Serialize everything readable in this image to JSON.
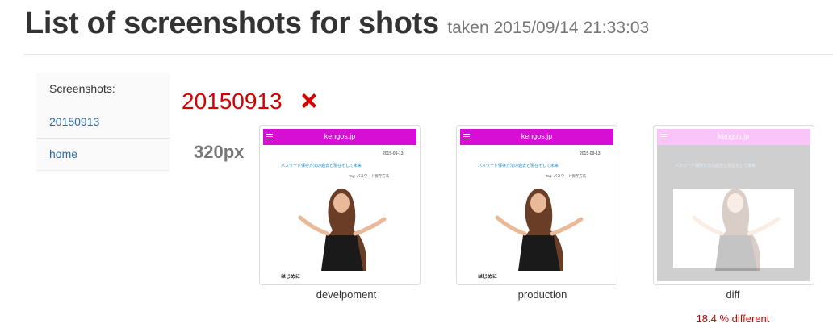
{
  "header": {
    "title": "List of screenshots for shots",
    "taken": "taken 2015/09/14 21:33:03"
  },
  "sidebar": {
    "heading": "Screenshots:",
    "items": [
      {
        "label": "20150913"
      },
      {
        "label": "home"
      }
    ]
  },
  "main": {
    "run_title": "20150913",
    "status_icon": "fail-x-icon",
    "size_label": "320px",
    "shots": [
      {
        "caption": "develpoment"
      },
      {
        "caption": "production"
      },
      {
        "caption": "diff"
      }
    ],
    "diff_percent": "18.4 % different"
  },
  "mini_page": {
    "brand": "kengos.jp",
    "date": "2015-09-13",
    "post_title": "パスワード保存方法の過去と現在そして未来",
    "tag": "Tag: パスワード保存方法",
    "heading": "はじめに"
  },
  "colors": {
    "accent_magenta": "#d70ed4",
    "error_red": "#d40000",
    "link_blue": "#2a6aa8"
  }
}
